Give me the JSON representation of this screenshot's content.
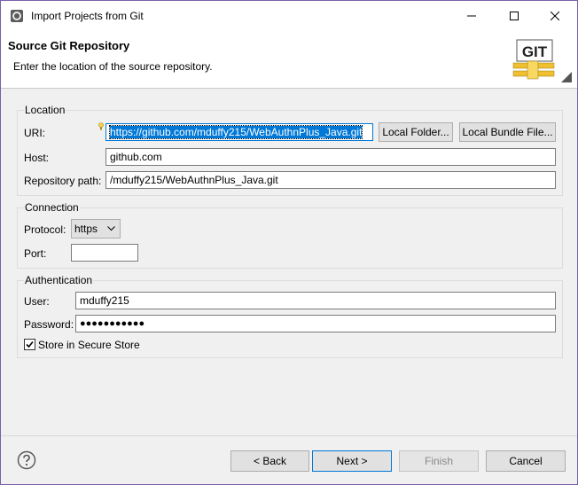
{
  "window": {
    "title": "Import Projects from Git"
  },
  "header": {
    "title": "Source Git Repository",
    "description": "Enter the location of the source repository.",
    "logo_text": "GIT"
  },
  "location": {
    "group_title": "Location",
    "uri_label": "URI:",
    "uri_value": "https://github.com/mduffy215/WebAuthnPlus_Java.git",
    "local_folder_label": "Local Folder...",
    "local_bundle_label": "Local Bundle File...",
    "host_label": "Host:",
    "host_value": "github.com",
    "repo_path_label": "Repository path:",
    "repo_path_value": "/mduffy215/WebAuthnPlus_Java.git"
  },
  "connection": {
    "group_title": "Connection",
    "protocol_label": "Protocol:",
    "protocol_value": "https",
    "port_label": "Port:",
    "port_value": ""
  },
  "authentication": {
    "group_title": "Authentication",
    "user_label": "User:",
    "user_value": "mduffy215",
    "password_label": "Password:",
    "password_value": "●●●●●●●●●●●",
    "store_label": "Store in Secure Store",
    "store_checked": true
  },
  "footer": {
    "back_label": "< Back",
    "next_label": "Next >",
    "finish_label": "Finish",
    "cancel_label": "Cancel"
  },
  "colors": {
    "accent": "#0078d7",
    "border": "#7b5fa8"
  }
}
